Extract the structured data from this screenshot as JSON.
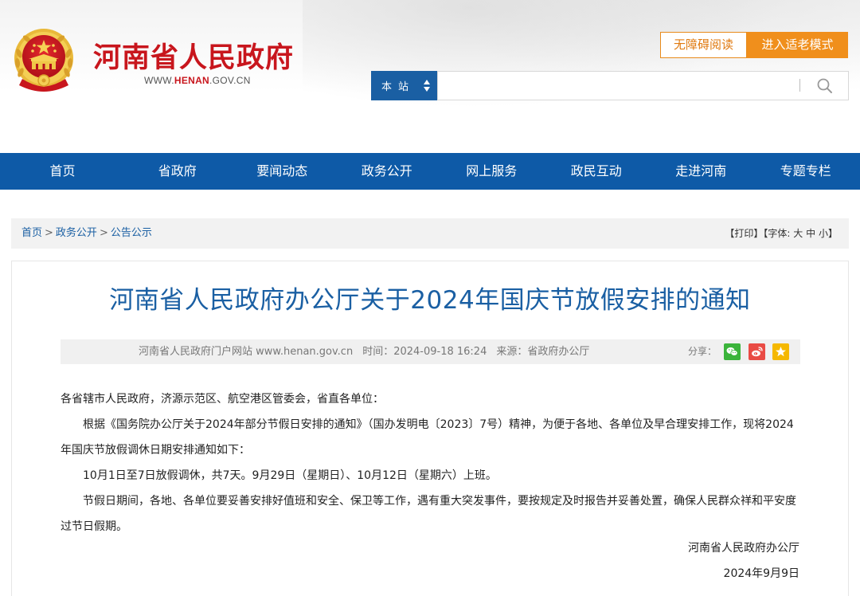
{
  "header": {
    "site_name": "河南省人民政府",
    "site_url_prefix": "WWW.",
    "site_url_domain": "HENAN",
    "site_url_suffix": ".GOV.CN",
    "accessibility_button": "无障碍阅读",
    "elder_mode_button": "进入适老模式",
    "search": {
      "scope": "本站",
      "placeholder": ""
    }
  },
  "nav": {
    "items": [
      "首页",
      "省政府",
      "要闻动态",
      "政务公开",
      "网上服务",
      "政民互动",
      "走进河南",
      "专题专栏"
    ]
  },
  "breadcrumb": {
    "items": [
      "首页",
      "政务公开",
      "公告公示"
    ],
    "separator": ">"
  },
  "tools": {
    "print": "【打印】",
    "font_label": "【字体:",
    "font_large": "大",
    "font_medium": "中",
    "font_small": "小",
    "font_close": "】"
  },
  "article": {
    "title": "河南省人民政府办公厅关于2024年国庆节放假安排的通知",
    "meta": {
      "source_site": "河南省人民政府门户网站 www.henan.gov.cn",
      "time": "时间：2024-09-18 16:24",
      "origin": "来源：省政府办公厅"
    },
    "share_label": "分享：",
    "paragraphs": [
      "各省辖市人民政府，济源示范区、航空港区管委会，省直各单位：",
      "根据《国务院办公厅关于2024年部分节假日安排的通知》（国办发明电〔2023〕7号）精神，为便于各地、各单位及早合理安排工作，现将2024年国庆节放假调休日期安排通知如下：",
      "10月1日至7日放假调休，共7天。9月29日（星期日）、10月12日（星期六）上班。",
      "节假日期间，各地、各单位要妥善安排好值班和安全、保卫等工作，遇有重大突发事件，要按规定及时报告并妥善处置，确保人民群众祥和平安度过节日假期。"
    ],
    "signature": "河南省人民政府办公厅",
    "date": "2024年9月9日"
  },
  "colors": {
    "brand_red": "#c8161d",
    "nav_blue": "#0e5aa7",
    "title_blue": "#1a5fa3",
    "accent_orange": "#f08f1c"
  },
  "icons": {
    "emblem": "national-emblem-icon",
    "search": "search-icon",
    "scope_sort": "sort-arrows-icon",
    "wechat": "wechat-icon",
    "weibo": "weibo-icon",
    "favorite": "star-icon"
  }
}
